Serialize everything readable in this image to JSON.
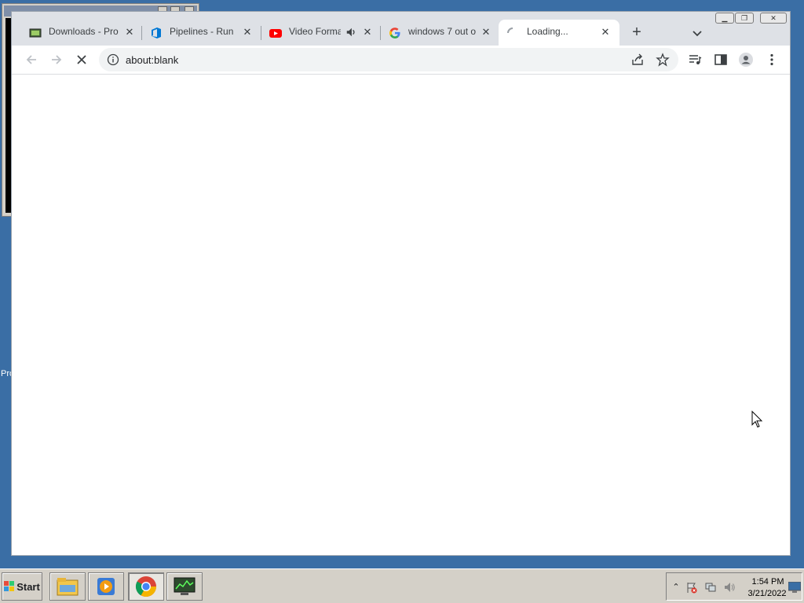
{
  "browser": {
    "tabs": [
      {
        "title": "Downloads - Pro",
        "icon": "downloads-icon",
        "active": false
      },
      {
        "title": "Pipelines - Run",
        "icon": "azure-devops-icon",
        "active": false
      },
      {
        "title": "Video Forma",
        "icon": "youtube-icon",
        "active": false,
        "audio": true
      },
      {
        "title": "windows 7 out o",
        "icon": "google-icon",
        "active": false
      },
      {
        "title": "Loading...",
        "icon": "loading-spinner-icon",
        "active": true
      }
    ],
    "address": "about:blank"
  },
  "background": {
    "desktop_text": "Pro"
  },
  "taskbar": {
    "start_label": "Start",
    "apps": [
      "file-explorer-icon",
      "media-player-icon",
      "chrome-icon",
      "task-manager-icon"
    ],
    "clock_time": "1:54 PM",
    "clock_date": "3/21/2022"
  },
  "colors": {
    "desktop": "#3a6ea5",
    "tab_strip": "#dee1e6",
    "omnibox": "#f1f3f4"
  }
}
